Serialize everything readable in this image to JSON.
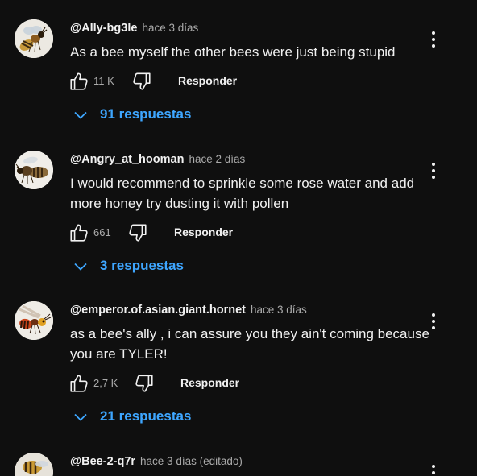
{
  "colors": {
    "background": "#0f0f0f",
    "text": "#f1f1f1",
    "secondary_text": "#aaaaaa",
    "link_blue": "#3ea6ff"
  },
  "comments": [
    {
      "author": "@Ally-bg3le",
      "time": "hace 3 días",
      "text": "As a bee myself the other bees were just being stupid",
      "likes": "11 K",
      "reply_label": "Responder",
      "replies_label": "91 respuestas",
      "avatar_icon": "bee-avatar-icon"
    },
    {
      "author": "@Angry_at_hooman",
      "time": "hace 2 días",
      "text": "I would recommend to sprinkle some rose water and add more honey try dusting it with pollen",
      "likes": "661",
      "reply_label": "Responder",
      "replies_label": "3 respuestas",
      "avatar_icon": "bee-avatar-icon"
    },
    {
      "author": "@emperor.of.asian.giant.hornet",
      "time": "hace 3 días",
      "text": "as a bee's ally , i can assure you they ain't coming because you are TYLER!",
      "likes": "2,7 K",
      "reply_label": "Responder",
      "replies_label": "21 respuestas",
      "avatar_icon": "hornet-avatar-icon"
    },
    {
      "author": "@Bee-2-q7r",
      "time": "hace 3 días (editado)",
      "avatar_icon": "bee-avatar-icon"
    }
  ]
}
